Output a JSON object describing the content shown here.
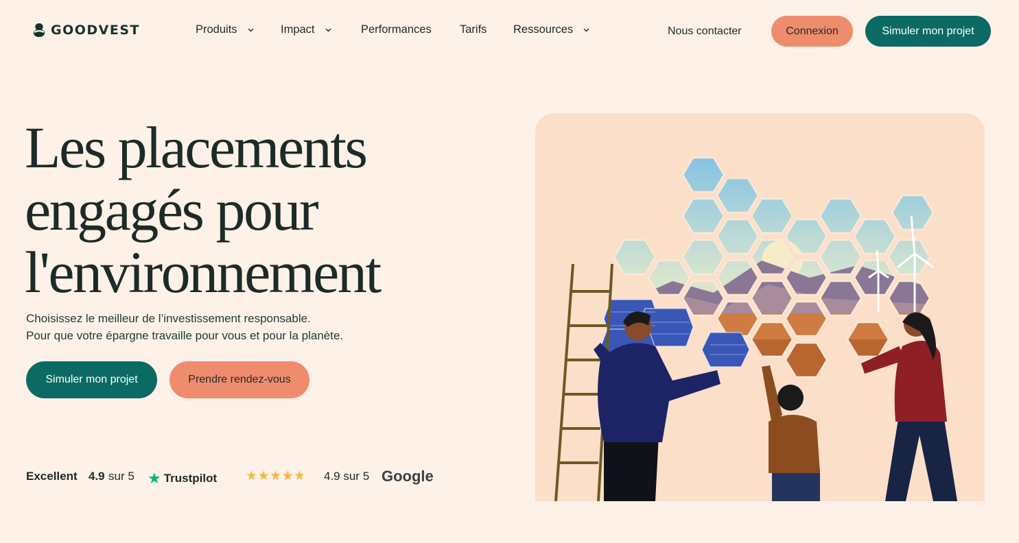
{
  "brand": {
    "name": "GOODVEST"
  },
  "nav": {
    "items": [
      {
        "label": "Produits",
        "has_dropdown": true
      },
      {
        "label": "Impact",
        "has_dropdown": true
      },
      {
        "label": "Performances",
        "has_dropdown": false
      },
      {
        "label": "Tarifs",
        "has_dropdown": false
      },
      {
        "label": "Ressources",
        "has_dropdown": true
      }
    ],
    "contact_label": "Nous contacter",
    "login_label": "Connexion",
    "simulate_label": "Simuler mon projet"
  },
  "hero": {
    "title_lines": [
      "Les placements",
      "engagés pour",
      "l'environnement"
    ],
    "subtitle_lines": [
      "Choisissez le meilleur de l’investissement responsable.",
      "Pour que votre épargne travaille pour vous et pour la planète."
    ],
    "primary_cta": "Simuler mon projet",
    "secondary_cta": "Prendre rendez-vous"
  },
  "ratings": {
    "trustpilot": {
      "label": "Excellent",
      "score": "4.9",
      "suffix": "sur 5",
      "brand": "Trustpilot"
    },
    "google": {
      "stars": "★★★★★",
      "score_text": "4.9 sur 5",
      "brand": "Google"
    }
  },
  "colors": {
    "background": "#fdf1e8",
    "primary_teal": "#0b6a63",
    "accent_coral": "#ef8c6d",
    "text_dark": "#1c2b27",
    "star_yellow": "#f5b836",
    "trustpilot_green": "#00b67a"
  },
  "icons": {
    "logo": "goodvest-logo-icon",
    "dropdown": "chevron-down-icon",
    "trustpilot": "trustpilot-star-icon",
    "rating": "star-icon"
  }
}
